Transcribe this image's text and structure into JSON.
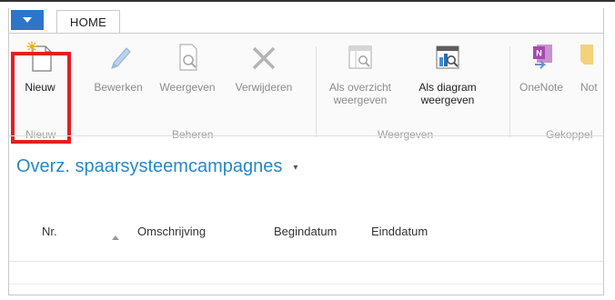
{
  "ribbon": {
    "tab_home": "HOME",
    "buttons": {
      "new": "Nieuw",
      "edit": "Bewerken",
      "view": "Weergeven",
      "delete": "Verwijderen",
      "as_list_1": "Als overzicht",
      "as_list_2": "weergeven",
      "as_chart_1": "Als diagram",
      "as_chart_2": "weergeven",
      "onenote": "OneNote",
      "notes": "Not"
    },
    "groups": {
      "new": "Nieuw",
      "manage": "Beheren",
      "view": "Weergeven",
      "linked": "Gekoppel"
    }
  },
  "page": {
    "title": "Overz. spaarsysteemcampagnes",
    "title_caret": "▾"
  },
  "table": {
    "columns": [
      "Nr.",
      "Omschrijving",
      "Begindatum",
      "Einddatum"
    ]
  },
  "colors": {
    "accent": "#2a86c7",
    "app_button": "#2e74c8",
    "highlight": "#e02020"
  }
}
